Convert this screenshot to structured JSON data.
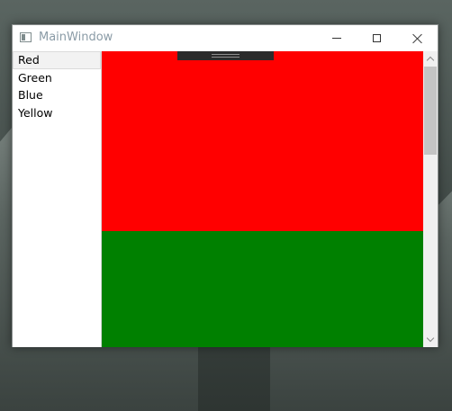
{
  "window": {
    "title": "MainWindow"
  },
  "list": {
    "items": [
      {
        "label": "Red",
        "selected": true
      },
      {
        "label": "Green",
        "selected": false
      },
      {
        "label": "Blue",
        "selected": false
      },
      {
        "label": "Yellow",
        "selected": false
      }
    ]
  },
  "panels": [
    {
      "name": "red",
      "color": "#ff0000"
    },
    {
      "name": "green",
      "color": "#008000"
    }
  ],
  "icons": {
    "app": "window-app-icon",
    "minimize": "minimize-icon",
    "maximize": "maximize-icon",
    "close": "close-icon",
    "scroll_up": "chevron-up-icon",
    "scroll_down": "chevron-down-icon"
  }
}
